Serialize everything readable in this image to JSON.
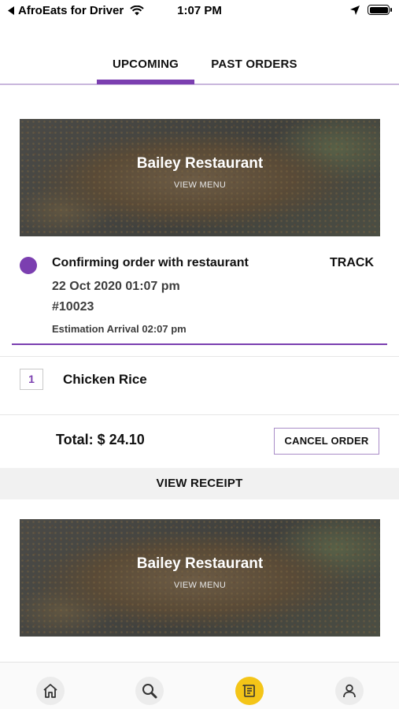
{
  "status_bar": {
    "back_app": "AfroEats for Driver",
    "time": "1:07 PM",
    "icons": [
      "back-arrow-icon",
      "wifi-icon",
      "location-arrow-icon",
      "battery-icon"
    ]
  },
  "tabs": [
    {
      "label": "UPCOMING",
      "active": true
    },
    {
      "label": "PAST ORDERS",
      "active": false
    }
  ],
  "orders": [
    {
      "restaurant": "Bailey Restaurant",
      "view_menu": "VIEW MENU",
      "status": "Confirming order with restaurant",
      "track_label": "TRACK",
      "date": "22 Oct 2020 01:07 pm",
      "number": "#10023",
      "eta": "Estimation Arrival 02:07 pm",
      "items": [
        {
          "qty": "1",
          "name": "Chicken Rice"
        }
      ],
      "total": "Total: $ 24.10",
      "cancel_label": "CANCEL ORDER",
      "receipt_label": "VIEW RECEIPT"
    },
    {
      "restaurant": "Bailey Restaurant",
      "view_menu": "VIEW MENU"
    }
  ],
  "bottom_nav": [
    {
      "icon": "home-icon",
      "active": false
    },
    {
      "icon": "search-icon",
      "active": false
    },
    {
      "icon": "orders-icon",
      "active": true
    },
    {
      "icon": "profile-icon",
      "active": false
    }
  ],
  "colors": {
    "accent": "#7b3fb0",
    "active_nav": "#f4c518",
    "receipt_bar": "#f1f1f1"
  }
}
